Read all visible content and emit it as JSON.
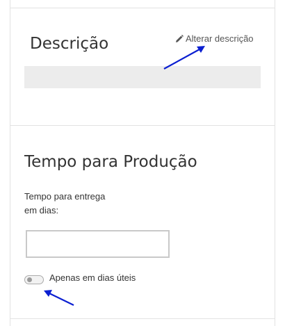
{
  "description_section": {
    "title": "Descrição",
    "edit_link_label": "Alterar descrição",
    "edit_icon": "pencil-icon"
  },
  "production_section": {
    "title": "Tempo para Produção",
    "field_label_line1": "Tempo para entrega",
    "field_label_line2": "em dias:",
    "days_input_value": "",
    "business_days_toggle": {
      "label": "Apenas em dias úteis",
      "checked": false
    }
  },
  "colors": {
    "annotation_arrow": "#0b1fd1",
    "border": "#e2e2e2",
    "description_box": "#ececec"
  }
}
